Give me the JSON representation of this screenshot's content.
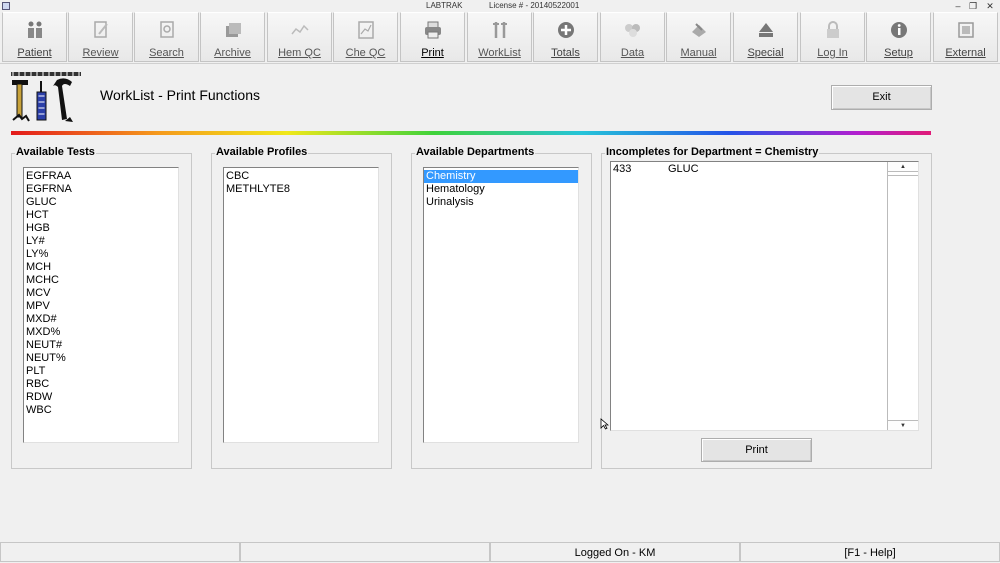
{
  "window": {
    "title": "LABTRAK",
    "license": "License # - 20140522001",
    "controls": [
      "–",
      "❐",
      "✕"
    ]
  },
  "toolbar": {
    "buttons": [
      {
        "label": "Patient",
        "icon": "patient-icon"
      },
      {
        "label": "Review",
        "icon": "review-icon"
      },
      {
        "label": "Search",
        "icon": "search-icon"
      },
      {
        "label": "Archive",
        "icon": "archive-icon"
      },
      {
        "label": "Hem QC",
        "icon": "hem-qc-icon"
      },
      {
        "label": "Che QC",
        "icon": "che-qc-icon"
      },
      {
        "label": "Print",
        "icon": "print-icon"
      },
      {
        "label": "WorkList",
        "icon": "worklist-icon"
      },
      {
        "label": "Totals",
        "icon": "totals-icon"
      },
      {
        "label": "Data",
        "icon": "data-icon"
      },
      {
        "label": "Manual",
        "icon": "manual-icon"
      },
      {
        "label": "Special",
        "icon": "special-icon"
      },
      {
        "label": "Log In",
        "icon": "lock-icon"
      },
      {
        "label": "Setup",
        "icon": "info-icon"
      },
      {
        "label": "External",
        "icon": "external-icon"
      }
    ]
  },
  "header": {
    "title": "WorkList - Print Functions",
    "exit_label": "Exit"
  },
  "available_tests": {
    "title": "Available Tests",
    "items": [
      "EGFRAA",
      "EGFRNA",
      "GLUC",
      "HCT",
      "HGB",
      "LY#",
      "LY%",
      "MCH",
      "MCHC",
      "MCV",
      "MPV",
      "MXD#",
      "MXD%",
      "NEUT#",
      "NEUT%",
      "PLT",
      "RBC",
      "RDW",
      "WBC"
    ]
  },
  "available_profiles": {
    "title": "Available Profiles",
    "items": [
      "CBC",
      "METHLYTE8"
    ]
  },
  "available_departments": {
    "title": "Available Departments",
    "items": [
      "Chemistry",
      "Hematology",
      "Urinalysis"
    ],
    "selected": "Chemistry"
  },
  "incompletes": {
    "title": "Incompletes for Department = Chemistry",
    "rows": [
      {
        "id": "433",
        "test": "GLUC"
      }
    ],
    "print_label": "Print"
  },
  "statusbar": {
    "panel1": "",
    "panel2": "",
    "logged_on": "Logged On - KM",
    "help": "[F1 - Help]"
  },
  "colors": {
    "selection": "#3399ff",
    "background": "#f0f0f0"
  }
}
